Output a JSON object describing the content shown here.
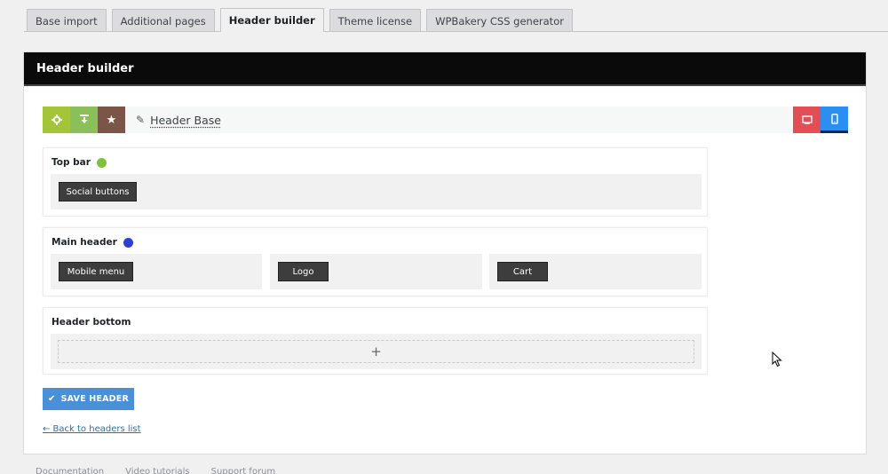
{
  "tabs": [
    {
      "label": "Base import",
      "active": false
    },
    {
      "label": "Additional pages",
      "active": false
    },
    {
      "label": "Header builder",
      "active": true
    },
    {
      "label": "Theme license",
      "active": false
    },
    {
      "label": "WPBakery CSS generator",
      "active": false
    }
  ],
  "panel": {
    "title": "Header builder"
  },
  "toolbar": {
    "left_icons": [
      "gear-icon",
      "download-icon",
      "star-icon"
    ],
    "header_name": "Header Base",
    "right_icons": [
      "desktop-icon",
      "mobile-icon"
    ],
    "colors": {
      "gear": "#a4c43a",
      "download": "#8bbf5a",
      "star": "#7b5547",
      "desktop": "#e24e56",
      "mobile": "#2a8ff0"
    }
  },
  "sections": {
    "top_bar": {
      "title": "Top bar",
      "dot_color": "#7ec13b",
      "buttons": [
        "Social buttons"
      ]
    },
    "main_header": {
      "title": "Main header",
      "dot_color": "#2c3fd6",
      "buttons": [
        "Mobile menu",
        "Logo",
        "Cart"
      ]
    },
    "header_bottom": {
      "title": "Header bottom",
      "add_label": "+"
    }
  },
  "actions": {
    "save_label": "SAVE HEADER",
    "back_label": "← Back to headers list"
  },
  "footer": {
    "items": [
      "Documentation",
      "Video tutorials",
      "Support forum"
    ]
  }
}
